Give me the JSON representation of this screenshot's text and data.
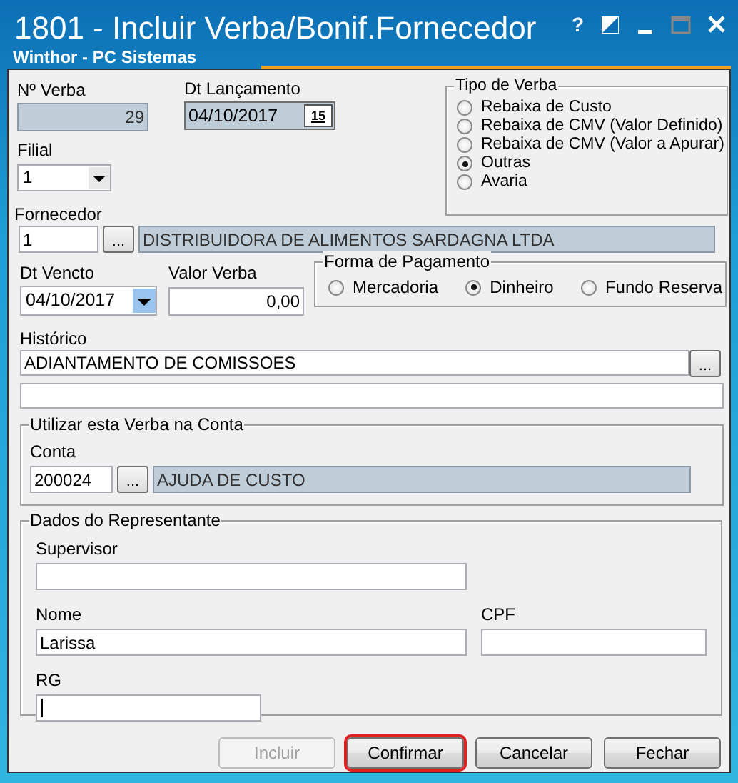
{
  "window": {
    "title": "1801 - Incluir Verba/Bonif.Fornecedor",
    "subtitle": "Winthor - PC Sistemas",
    "help_button": "?"
  },
  "numero_verba": {
    "label": "Nº Verba",
    "value": "29"
  },
  "dt_lancamento": {
    "label": "Dt Lançamento",
    "value": "04/10/2017",
    "picker_label": "15"
  },
  "filial": {
    "label": "Filial",
    "value": "1"
  },
  "tipo_de_verba": {
    "title": "Tipo de Verba",
    "options": [
      {
        "label": "Rebaixa de Custo",
        "selected": false
      },
      {
        "label": "Rebaixa de CMV (Valor Definido)",
        "selected": false
      },
      {
        "label": "Rebaixa de CMV (Valor a Apurar)",
        "selected": false
      },
      {
        "label": "Outras",
        "selected": true
      },
      {
        "label": "Avaria",
        "selected": false
      }
    ]
  },
  "fornecedor": {
    "label": "Fornecedor",
    "code": "1",
    "browse_button": "...",
    "name": "DISTRIBUIDORA DE ALIMENTOS SARDAGNA LTDA"
  },
  "dt_vencto": {
    "label": "Dt Vencto",
    "value": "04/10/2017"
  },
  "valor_verba": {
    "label": "Valor Verba",
    "value": "0,00"
  },
  "forma_de_pagamento": {
    "title": "Forma de Pagamento",
    "options": [
      {
        "label": "Mercadoria",
        "selected": false
      },
      {
        "label": "Dinheiro",
        "selected": true
      },
      {
        "label": "Fundo Reserva",
        "selected": false
      }
    ]
  },
  "historico": {
    "label": "Histórico",
    "value": "ADIANTAMENTO DE COMISSOES",
    "browse_button": "..."
  },
  "conta_group": {
    "title": "Utilizar esta Verba na Conta",
    "label": "Conta",
    "code": "200024",
    "browse_button": "...",
    "name": "AJUDA DE CUSTO"
  },
  "representante": {
    "title": "Dados do Representante",
    "supervisor": {
      "label": "Supervisor"
    },
    "nome": {
      "label": "Nome",
      "value": "Larissa"
    },
    "cpf": {
      "label": "CPF"
    },
    "rg": {
      "label": "RG",
      "focused": true
    }
  },
  "buttons": [
    {
      "label": "Incluir",
      "disabled": true,
      "highlighted": false
    },
    {
      "label": "Confirmar",
      "disabled": false,
      "highlighted": true
    },
    {
      "label": "Cancelar",
      "disabled": false,
      "highlighted": false
    },
    {
      "label": "Fechar",
      "disabled": false,
      "highlighted": false
    }
  ]
}
